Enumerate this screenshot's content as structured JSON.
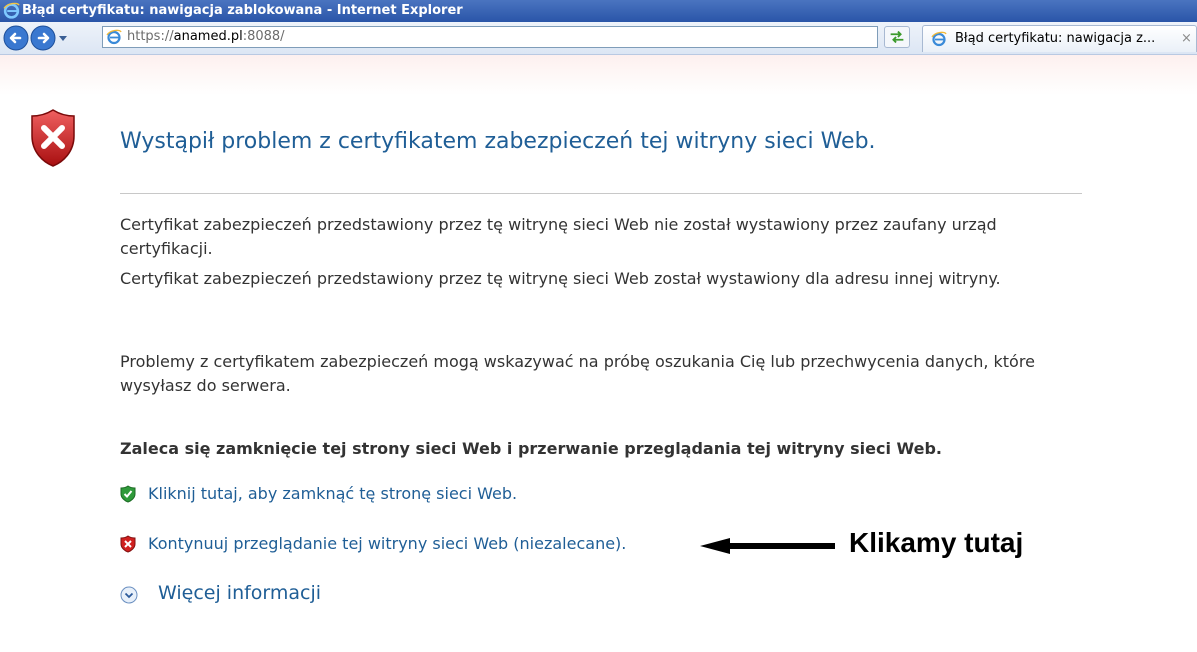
{
  "window": {
    "title": "Błąd certyfikatu: nawigacja zablokowana - Internet Explorer"
  },
  "navbar": {
    "address": {
      "scheme": "https://",
      "host": "anamed.pl",
      "port": ":8088/"
    },
    "tab": {
      "label": "Błąd certyfikatu: nawigacja z...",
      "close": "×"
    }
  },
  "page": {
    "heading": "Wystąpił problem z certyfikatem zabezpieczeń tej witryny sieci Web.",
    "paragraphs": [
      "Certyfikat zabezpieczeń przedstawiony przez tę witrynę sieci Web nie został wystawiony przez zaufany urząd certyfikacji.",
      "Certyfikat zabezpieczeń przedstawiony przez tę witrynę sieci Web został wystawiony dla adresu innej witryny.",
      "Problemy z certyfikatem zabezpieczeń mogą wskazywać na próbę oszukania Cię lub przechwycenia danych, które wysyłasz do serwera."
    ],
    "recommendation": "Zaleca się zamknięcie tej strony sieci Web i przerwanie przeglądania tej witryny sieci Web.",
    "links": {
      "close": "Kliknij tutaj, aby zamknąć tę stronę sieci Web.",
      "continue": "Kontynuuj przeglądanie tej witryny sieci Web (niezalecane)."
    },
    "more_info": "Więcej informacji",
    "annotation": "Klikamy tutaj"
  },
  "colors": {
    "link": "#1f5e96",
    "titlebar": "#2a55a8",
    "shield_red": "#d0201f",
    "shield_green": "#2f9a3a"
  }
}
